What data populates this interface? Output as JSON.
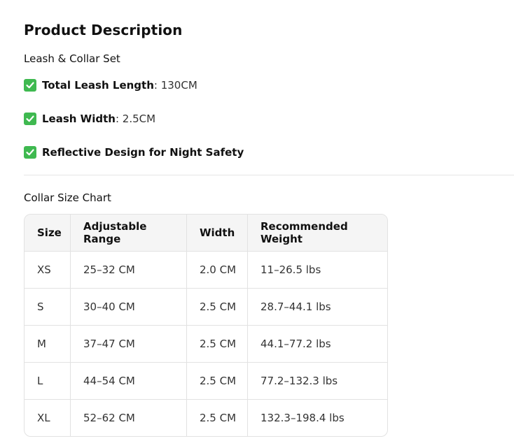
{
  "heading": "Product Description",
  "subtitle": "Leash & Collar Set",
  "features": [
    {
      "label": "Total Leash Length",
      "value": ": 130CM"
    },
    {
      "label": "Leash Width",
      "value": ": 2.5CM"
    },
    {
      "label": "Reflective Design for Night Safety",
      "value": ""
    }
  ],
  "icons": {
    "feature_marker": "check-mark-icon",
    "check_color": "#3fb950"
  },
  "chart_title": "Collar Size Chart",
  "table": {
    "headers": [
      "Size",
      "Adjustable Range",
      "Width",
      "Recommended Weight"
    ],
    "rows": [
      [
        "XS",
        "25–32 CM",
        "2.0 CM",
        "11–26.5 lbs"
      ],
      [
        "S",
        "30–40 CM",
        "2.5 CM",
        "28.7–44.1 lbs"
      ],
      [
        "M",
        "37–47 CM",
        "2.5 CM",
        "44.1–77.2 lbs"
      ],
      [
        "L",
        "44–54 CM",
        "2.5 CM",
        "77.2–132.3 lbs"
      ],
      [
        "XL",
        "52–62 CM",
        "2.5 CM",
        "132.3–198.4 lbs"
      ]
    ]
  }
}
